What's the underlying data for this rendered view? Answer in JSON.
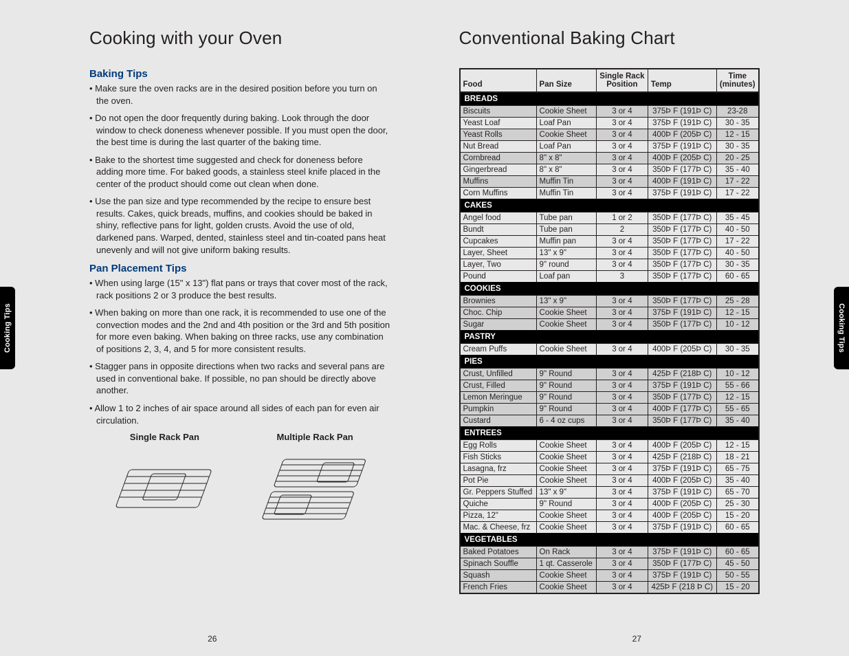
{
  "left": {
    "title": "Cooking with your Oven",
    "tab": "Cooking Tips",
    "s1": {
      "heading": "Baking Tips",
      "tips": [
        "Make sure the oven racks are in the desired position before you turn on the oven.",
        "Do not open the door frequently during baking.  Look through the door window to check doneness whenever possible.  If you must open the door, the best time is during the last quarter of the baking time.",
        "Bake to the shortest time suggested and check for doneness before adding more time.  For baked goods, a stainless steel knife placed in the center of the product should come out clean when done.",
        "Use the pan size and type recommended by the recipe to ensure best results.  Cakes, quick breads, muffins, and cookies should be baked in shiny, reflective pans for light, golden crusts.  Avoid the use of old, darkened pans.  Warped, dented, stainless steel and tin-coated pans heat unevenly and will not give uniform baking results."
      ]
    },
    "s2": {
      "heading": "Pan Placement Tips",
      "tips": [
        "When using large (15\" x 13\") flat pans or trays that cover  most of the rack, rack positions 2 or 3 produce the best results.",
        "When baking on more than one rack, it is recommended to use one of the convection modes and the 2nd and 4th position or the 3rd and 5th position for more even baking.  When baking on three racks, use any combination of positions 2, 3, 4, and 5 for more consistent results.",
        "Stagger pans in opposite directions when two racks and several pans are used in conventional bake.  If possible, no pan should be directly above another.",
        "Allow 1 to 2 inches of air space around all sides of each pan for even air circulation."
      ]
    },
    "illus": {
      "single": "Single Rack Pan",
      "multi": "Multiple Rack Pan"
    },
    "pagenum": "26"
  },
  "right": {
    "title": "Conventional Baking Chart",
    "tab": "Cooking Tips",
    "pagenum": "27",
    "headers": [
      "Food",
      "Pan Size",
      "Single Rack\nPosition",
      "Temp",
      "Time\n(minutes)"
    ]
  },
  "chart_data": {
    "type": "table",
    "title": "Conventional Baking Chart",
    "columns": [
      "Food",
      "Pan Size",
      "Single Rack Position",
      "Temp",
      "Time (minutes)"
    ],
    "sections": [
      {
        "name": "BREADS",
        "rows": [
          {
            "food": "Biscuits",
            "pan": "Cookie Sheet",
            "pos": "3 or 4",
            "temp": "375Þ F (191Þ C)",
            "time": "23-28",
            "alt": true
          },
          {
            "food": "Yeast Loaf",
            "pan": "Loaf Pan",
            "pos": "3 or 4",
            "temp": "375Þ F (191Þ C)",
            "time": "30 - 35"
          },
          {
            "food": "Yeast Rolls",
            "pan": "Cookie Sheet",
            "pos": "3 or 4",
            "temp": "400Þ F (205Þ C)",
            "time": "12 - 15",
            "alt": true
          },
          {
            "food": "Nut Bread",
            "pan": "Loaf Pan",
            "pos": "3 or 4",
            "temp": "375Þ F (191Þ C)",
            "time": "30 - 35"
          },
          {
            "food": "Cornbread",
            "pan": "8\" x 8\"",
            "pos": "3 or 4",
            "temp": "400Þ F (205Þ C)",
            "time": "20 - 25",
            "alt": true
          },
          {
            "food": "Gingerbread",
            "pan": "8\" x 8\"",
            "pos": "3 or 4",
            "temp": "350Þ F (177Þ C)",
            "time": "35 - 40"
          },
          {
            "food": "Muffins",
            "pan": "Muffin Tin",
            "pos": "3 or 4",
            "temp": "400Þ F (191Þ C)",
            "time": "17 - 22",
            "alt": true
          },
          {
            "food": "Corn Muffins",
            "pan": "Muffin Tin",
            "pos": "3 or 4",
            "temp": "375Þ F (191Þ C)",
            "time": "17 - 22"
          }
        ]
      },
      {
        "name": "CAKES",
        "rows": [
          {
            "food": "Angel food",
            "pan": "Tube pan",
            "pos": "1 or 2",
            "temp": "350Þ F (177Þ C)",
            "time": "35 - 45"
          },
          {
            "food": "Bundt",
            "pan": "Tube pan",
            "pos": "2",
            "temp": "350Þ F (177Þ C)",
            "time": "40 - 50"
          },
          {
            "food": "Cupcakes",
            "pan": "Muffin pan",
            "pos": "3 or 4",
            "temp": "350Þ F (177Þ C)",
            "time": "17 - 22"
          },
          {
            "food": "Layer, Sheet",
            "pan": "13\" x 9\"",
            "pos": "3 or 4",
            "temp": "350Þ F (177Þ C)",
            "time": "40 - 50"
          },
          {
            "food": "Layer, Two",
            "pan": "9\" round",
            "pos": "3 or 4",
            "temp": "350Þ F (177Þ C)",
            "time": "30 - 35"
          },
          {
            "food": "Pound",
            "pan": "Loaf pan",
            "pos": "3",
            "temp": "350Þ F (177Þ C)",
            "time": "60 - 65"
          }
        ]
      },
      {
        "name": "COOKIES",
        "rows": [
          {
            "food": "Brownies",
            "pan": "13\" x 9\"",
            "pos": "3 or 4",
            "temp": "350Þ F (177Þ C)",
            "time": "25 - 28",
            "alt": true
          },
          {
            "food": "Choc. Chip",
            "pan": "Cookie Sheet",
            "pos": "3 or 4",
            "temp": "375Þ F (191Þ C)",
            "time": "12 - 15",
            "alt": true
          },
          {
            "food": "Sugar",
            "pan": "Cookie Sheet",
            "pos": "3 or 4",
            "temp": "350Þ F (177Þ C)",
            "time": "10 - 12",
            "alt": true
          }
        ]
      },
      {
        "name": "PASTRY",
        "rows": [
          {
            "food": "Cream Puffs",
            "pan": "Cookie Sheet",
            "pos": "3 or 4",
            "temp": "400Þ F (205Þ C)",
            "time": "30 - 35"
          }
        ]
      },
      {
        "name": "PIES",
        "rows": [
          {
            "food": "Crust, Unfilled",
            "pan": "9\" Round",
            "pos": "3 or 4",
            "temp": "425Þ F (218Þ C)",
            "time": "10 - 12",
            "alt": true
          },
          {
            "food": "Crust, Filled",
            "pan": "9\" Round",
            "pos": "3 or 4",
            "temp": "375Þ F (191Þ C)",
            "time": "55 - 66",
            "alt": true
          },
          {
            "food": "Lemon Meringue",
            "pan": "9\" Round",
            "pos": "3 or 4",
            "temp": "350Þ F (177Þ C)",
            "time": "12 - 15",
            "alt": true
          },
          {
            "food": "Pumpkin",
            "pan": "9\" Round",
            "pos": "3 or 4",
            "temp": "400Þ F (177Þ C)",
            "time": "55 - 65",
            "alt": true
          },
          {
            "food": "Custard",
            "pan": "6 - 4 oz cups",
            "pos": "3 or 4",
            "temp": "350Þ F (177Þ C)",
            "time": "35 - 40",
            "alt": true
          }
        ]
      },
      {
        "name": "ENTREES",
        "rows": [
          {
            "food": "Egg Rolls",
            "pan": "Cookie Sheet",
            "pos": "3 or 4",
            "temp": "400Þ F (205Þ C)",
            "time": "12 - 15"
          },
          {
            "food": "Fish Sticks",
            "pan": "Cookie Sheet",
            "pos": "3 or 4",
            "temp": "425Þ F (218Þ C)",
            "time": "18 - 21"
          },
          {
            "food": "Lasagna, frz",
            "pan": "Cookie Sheet",
            "pos": "3 or 4",
            "temp": "375Þ F (191Þ C)",
            "time": "65 - 75"
          },
          {
            "food": "Pot Pie",
            "pan": "Cookie Sheet",
            "pos": "3 or 4",
            "temp": "400Þ F (205Þ C)",
            "time": "35 - 40"
          },
          {
            "food": "Gr. Peppers Stuffed",
            "pan": "13\" x 9\"",
            "pos": "3 or 4",
            "temp": "375Þ F (191Þ C)",
            "time": "65 - 70"
          },
          {
            "food": "Quiche",
            "pan": "9\" Round",
            "pos": "3 or 4",
            "temp": "400Þ F (205Þ C)",
            "time": "25 - 30"
          },
          {
            "food": "Pizza, 12\"",
            "pan": "Cookie Sheet",
            "pos": "3 or 4",
            "temp": "400Þ F (205Þ C)",
            "time": "15 - 20"
          },
          {
            "food": "Mac. & Cheese, frz",
            "pan": "Cookie Sheet",
            "pos": "3 or 4",
            "temp": "375Þ F (191Þ C)",
            "time": "60 - 65"
          }
        ]
      },
      {
        "name": "VEGETABLES",
        "rows": [
          {
            "food": "Baked Potatoes",
            "pan": "On Rack",
            "pos": "3 or 4",
            "temp": "375Þ F (191Þ C)",
            "time": "60 - 65",
            "alt": true
          },
          {
            "food": "Spinach Souffle",
            "pan": "1 qt. Casserole",
            "pos": "3 or 4",
            "temp": "350Þ F (177Þ C)",
            "time": "45 - 50",
            "alt": true
          },
          {
            "food": "Squash",
            "pan": "Cookie Sheet",
            "pos": "3 or 4",
            "temp": "375Þ F (191Þ C)",
            "time": "50 - 55",
            "alt": true
          },
          {
            "food": "French Fries",
            "pan": "Cookie Sheet",
            "pos": "3 or 4",
            "temp": "425Þ F (218 Þ C)",
            "time": "15 - 20",
            "alt": true
          }
        ]
      }
    ]
  }
}
